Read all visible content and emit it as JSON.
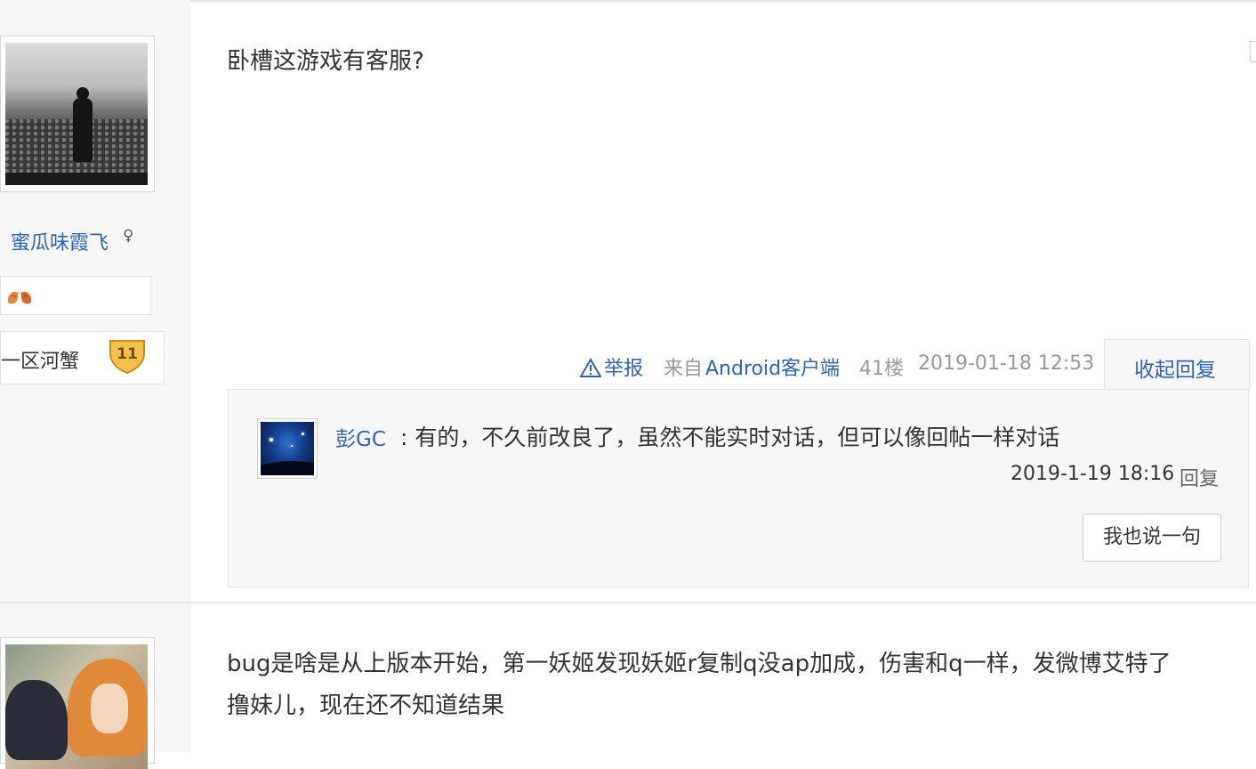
{
  "post1": {
    "username": "蜜瓜味霞飞",
    "gender_icon": "♀",
    "level_name": "一区河蟹",
    "level_num": "11",
    "content": "卧槽这游戏有客服?",
    "report_label": "举报",
    "from_label": "来自",
    "client_label": "Android客户端",
    "floor": "41楼",
    "time": "2019-01-18 12:53",
    "collapse_label": "收起回复"
  },
  "reply": {
    "user": "彭GC",
    "text": ": 有的，不久前改良了，虽然不能实时对话，但可以像回帖一样对话",
    "time": "2019-1-19 18:16",
    "reply_link": "回复",
    "say_button": "我也说一句"
  },
  "post2": {
    "lines": [
      "bug是啥是从上版本开始，第一妖姬发现妖姬r复制q没ap加成，伤害和q一样，发微博艾特了",
      "撸妹儿，现在还不知道结果"
    ]
  },
  "colors": {
    "link": "#2d64b3",
    "muted": "#999999",
    "text": "#333333",
    "level_badge": "#e8b23a"
  },
  "icons": [
    "warning-icon",
    "lung-icon",
    "level-shield-icon",
    "gender-icon"
  ]
}
